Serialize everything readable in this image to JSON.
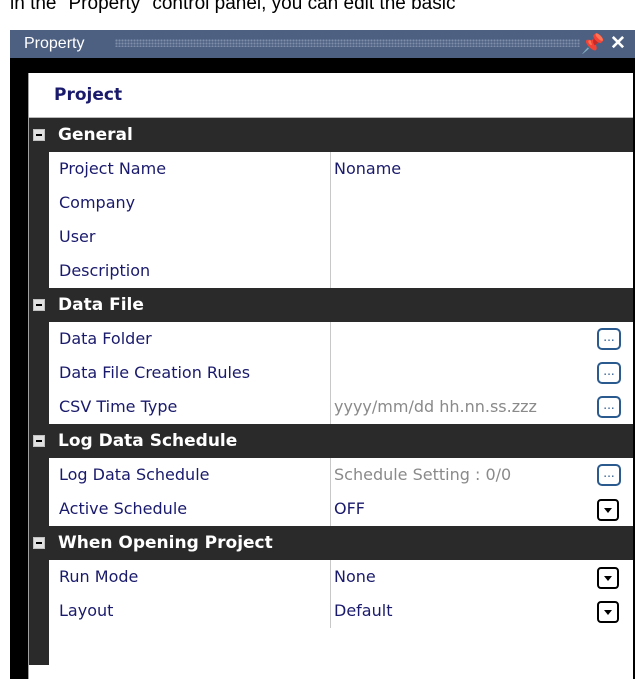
{
  "caption": "in the \"Property\" control panel, you can edit the basic",
  "panel": {
    "title": "Property",
    "pin_glyph": "p",
    "close_glyph": "✕",
    "pin_icon": "pin-icon",
    "close_icon": "close-icon"
  },
  "object_title": "Project",
  "categories": [
    {
      "label": "General",
      "props": [
        {
          "name": "Project Name",
          "value": "Noname",
          "editor": "none"
        },
        {
          "name": "Company",
          "value": "",
          "editor": "none"
        },
        {
          "name": "User",
          "value": "",
          "editor": "none"
        },
        {
          "name": "Description",
          "value": "",
          "editor": "none"
        }
      ]
    },
    {
      "label": "Data File",
      "props": [
        {
          "name": "Data Folder",
          "value": "",
          "editor": "ellipsis"
        },
        {
          "name": "Data File Creation Rules",
          "value": "",
          "editor": "ellipsis"
        },
        {
          "name": "CSV Time Type",
          "value": "yyyy/mm/dd hh.nn.ss.zzz",
          "editor": "ellipsis",
          "gray": true
        }
      ]
    },
    {
      "label": "Log Data Schedule",
      "props": [
        {
          "name": "Log Data Schedule",
          "value": "Schedule Setting : 0/0",
          "editor": "ellipsis",
          "gray": true
        },
        {
          "name": "Active Schedule",
          "value": "OFF",
          "editor": "dropdown"
        }
      ]
    },
    {
      "label": "When Opening Project",
      "props": [
        {
          "name": "Run Mode",
          "value": "None",
          "editor": "dropdown"
        },
        {
          "name": "Layout",
          "value": "Default",
          "editor": "dropdown"
        }
      ]
    }
  ],
  "ellipsis_text": "...",
  "colors": {
    "title_bar": "#4d6082",
    "category_bg": "#2a2a2a",
    "text_navy": "#1a1a6c",
    "value_gray": "#8a8a8a"
  }
}
